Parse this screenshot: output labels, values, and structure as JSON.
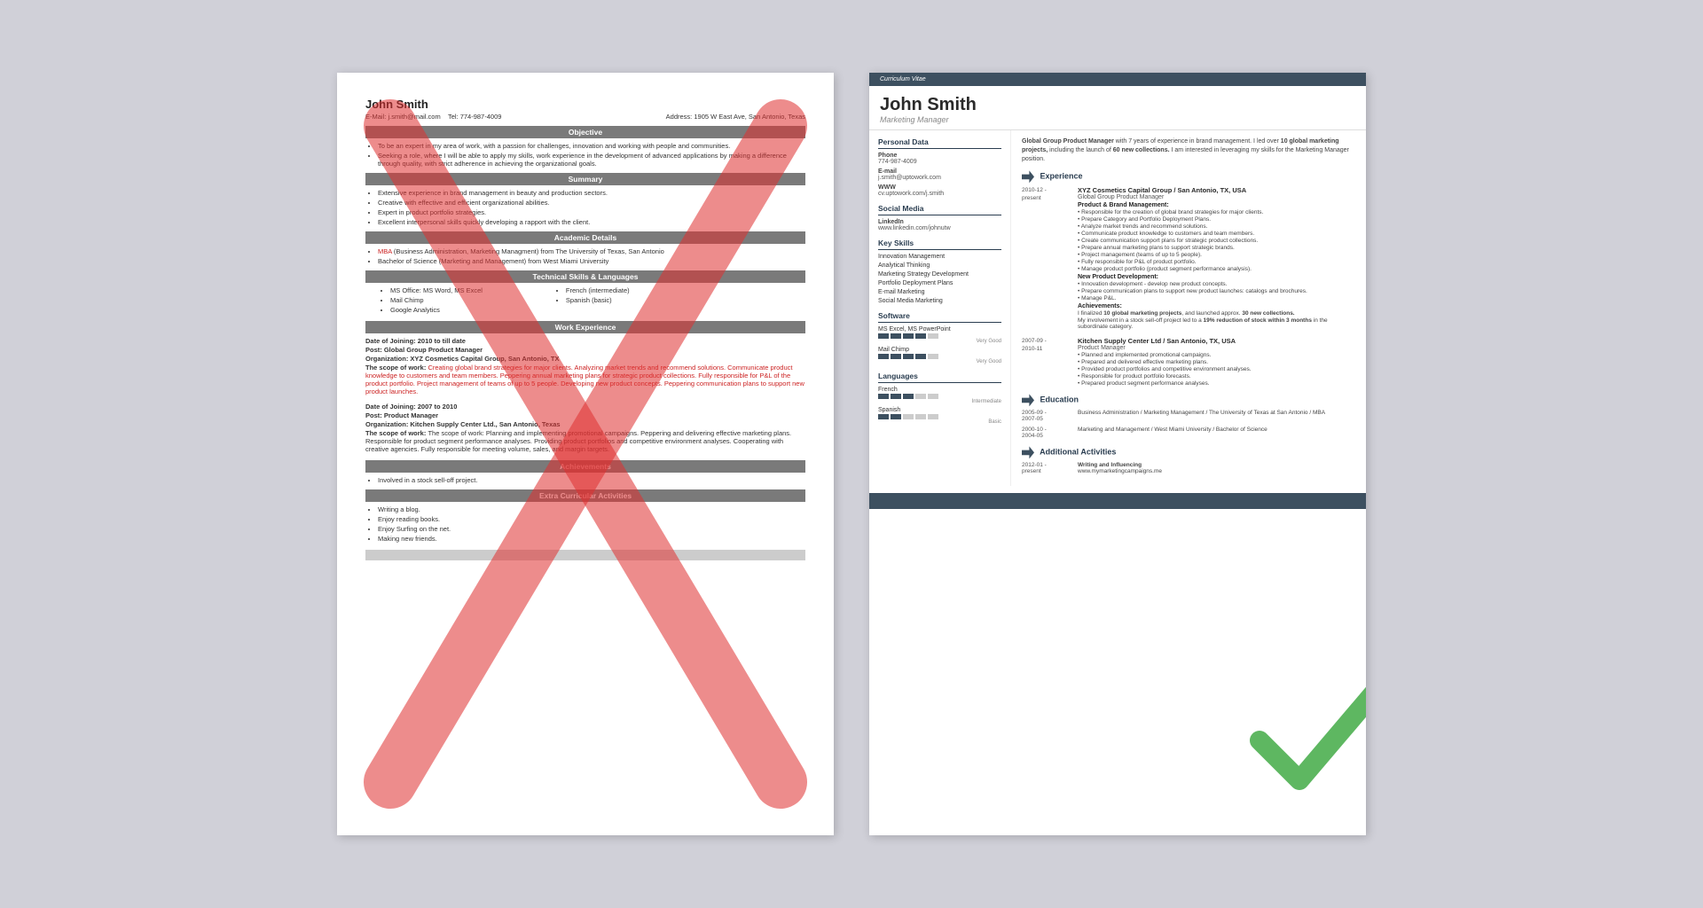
{
  "left_resume": {
    "name": "John Smith",
    "email_label": "E-Mail:",
    "email": "j.smith@mail.com",
    "address_label": "Address:",
    "address": "1905 W East Ave, San Antonio, Texas",
    "tel_label": "Tel:",
    "tel": "774-987-4009",
    "sections": {
      "objective": {
        "title": "Objective",
        "bullets": [
          "To be an expert in my area of work, with a passion for challenges, innovation and working with people and communities.",
          "Seeking a role, where I will be able to apply my skills, work experience in the development of advanced applications by making a difference through quality, with strict adherence in achieving the organizational goals."
        ]
      },
      "summary": {
        "title": "Summary",
        "bullets": [
          "Extensive experience in brand management in beauty and production sectors.",
          "Creative with effective and efficient organizational abilities.",
          "Expert in product portfolio strategies.",
          "Excellent interpersonal skills quickly developing a rapport with the client."
        ]
      },
      "academic": {
        "title": "Academic Details",
        "bullets": [
          "MBA (Business Administration, Marketing Managment) from The University of Texas, San Antonio",
          "Bachelor of Science (Marketing and Management) from West Miami University"
        ]
      },
      "technical": {
        "title": "Technical Skills & Languages",
        "skills": [
          "MS Office: MS Word, MS Excel",
          "Mail Chimp",
          "Google Analytics"
        ],
        "languages": [
          "French (intermediate)",
          "Spanish (basic)"
        ]
      },
      "work": {
        "title": "Work Experience",
        "entries": [
          {
            "date_of_joining": "Date of Joining: 2010 to till date",
            "post": "Post: Global Group Product Manager",
            "org": "Organization: XYZ Cosmetics Capital Group, San Antonio, TX",
            "scope": "The scope of work: Creating global brand strategies for major clients. Analyzing market trends and recommend solutions. Communicate product knowledge to customers and team members. Peppering annual marketing plans for strategic product collections. Fully responsible for P&L of the product portfolio. Project management of teams of up to 5 people. Developing new product concepts. Peppering communication plans to support new product launches."
          },
          {
            "date_of_joining": "Date of Joining: 2007 to 2010",
            "post": "Post: Product Manager",
            "org": "Organization: Kitchen Supply Center Ltd., San Antonio, Texas",
            "scope": "The scope of work: Planning and implementing promotional campaigns. Peppering and delivering effective marketing plans. Responsible for product segment performance analyses. Providing product portfolios and competitive environment analyses. Cooperating with creative agencies. Fully responsible for meeting volume, sales, and margin targets."
          }
        ]
      },
      "achievements": {
        "title": "Achievements",
        "bullets": [
          "Involved in a stock sell-off project."
        ]
      },
      "extracurricular": {
        "title": "Extra Curricular Activities",
        "bullets": [
          "Writing a blog.",
          "Enjoy reading books.",
          "Enjoy Surfing on the net.",
          "Making new friends."
        ]
      }
    }
  },
  "right_resume": {
    "curriculum_vitae": "Curriculum Vitae",
    "name": "John Smith",
    "title": "Marketing Manager",
    "personal_data": {
      "section": "Personal Data",
      "phone_label": "Phone",
      "phone": "774-987-4009",
      "email_label": "E-mail",
      "email": "j.smith@uptowork.com",
      "www_label": "WWW",
      "www": "cv.uptowork.com/j.smith",
      "social_label": "Social Media",
      "linkedin_label": "LinkedIn",
      "linkedin": "www.linkedin.com/johnutw"
    },
    "key_skills": {
      "section": "Key Skills",
      "items": [
        "Innovation Management",
        "Analytical Thinking",
        "Marketing Strategy Development",
        "Portfolio Deployment Plans",
        "E-mail Marketing",
        "Social Media Marketing"
      ]
    },
    "software": {
      "section": "Software",
      "items": [
        {
          "name": "MS Excel, MS PowerPoint",
          "bars": 4,
          "total": 5,
          "label": "Very Good"
        },
        {
          "name": "Mail Chimp",
          "bars": 4,
          "total": 5,
          "label": "Very Good"
        }
      ]
    },
    "languages": {
      "section": "Languages",
      "items": [
        {
          "name": "French",
          "bars": 3,
          "total": 5,
          "label": "Intermediate"
        },
        {
          "name": "Spanish",
          "bars": 2,
          "total": 5,
          "label": "Basic"
        }
      ]
    },
    "summary_text": "Global Group Product Manager with 7 years of experience in brand management. I led over 10 global marketing projects, including the launch of 60 new collections. I am interested in leveraging my skills for the Marketing Manager position.",
    "experience": {
      "section": "Experience",
      "entries": [
        {
          "date_start": "2010-12 -",
          "date_end": "present",
          "company": "XYZ Cosmetics Capital Group / San Antonio, TX, USA",
          "role": "Global Group Product Manager",
          "subtitle1": "Product & Brand Management:",
          "bullets1": [
            "• Responsible for the creation of global brand strategies for major clients.",
            "• Prepare Category and Portfolio Deployment Plans.",
            "• Analyze market trends and recommend solutions.",
            "• Communicate product knowledge to customers and team members.",
            "• Create communication support plans for strategic product collections.",
            "• Prepare annual marketing plans to support strategic brands.",
            "• Project management (teams of up to 5 people).",
            "• Fully responsible for P&L of product portfolio.",
            "• Manage product portfolio (product segment performance analysis)."
          ],
          "subtitle2": "New Product Development:",
          "bullets2": [
            "• Innovation development - develop new product concepts.",
            "• Prepare communication plans to support new product launches: catalogs and brochures.",
            "• Manage P&L."
          ],
          "subtitle3": "Achievements:",
          "bullets3": [
            "I finalized 10 global marketing projects, and launched approx. 30 new collections.",
            "My involvement in a stock sell-off project led to a 19% reduction of stock within 3 months in the subordinate category."
          ]
        },
        {
          "date_start": "2007-09 -",
          "date_end": "2010-11",
          "company": "Kitchen Supply Center Ltd / San Antonio, TX, USA",
          "role": "Product Manager",
          "bullets1": [
            "• Planned and implemented promotional campaigns.",
            "• Prepared and delivered effective marketing plans.",
            "• Provided product portfolios and competitive environment analyses.",
            "• Responsible for product portfolio forecasts.",
            "• Prepared product segment performance analyses."
          ]
        }
      ]
    },
    "education": {
      "section": "Education",
      "entries": [
        {
          "date_start": "2005-09 -",
          "date_end": "2007-05",
          "content": "Business Administration / Marketing Management / The University of Texas at San Antonio / MBA"
        },
        {
          "date_start": "2000-10 -",
          "date_end": "2004-05",
          "content": "Marketing and Management / West Miami University / Bachelor of Science"
        }
      ]
    },
    "additional": {
      "section": "Additional Activities",
      "entries": [
        {
          "date_start": "2012-01 -",
          "date_end": "present",
          "title": "Writing and Influencing",
          "url": "www.mymarketingcampaigns.me"
        }
      ]
    }
  }
}
